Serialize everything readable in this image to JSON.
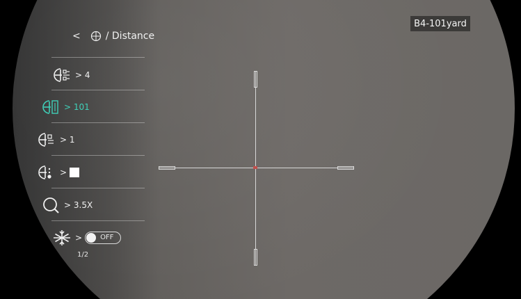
{
  "header": {
    "breadcrumb_chevron": "<",
    "breadcrumb_text": "/ Distance"
  },
  "profile_label": "B4-101yard",
  "menu": {
    "items": [
      {
        "icon": "reticle-group-icon",
        "value": "> 4",
        "active": false
      },
      {
        "icon": "profile-select-icon",
        "value": "> 101",
        "active": true
      },
      {
        "icon": "reticle-style-icon",
        "value": "> 1",
        "active": false
      },
      {
        "icon": "reticle-color-icon",
        "value": ">",
        "swatch_color": "#ffffff",
        "active": false
      },
      {
        "icon": "zoom-icon",
        "value": "> 3.5X",
        "active": false
      },
      {
        "icon": "freeze-icon",
        "value": ">",
        "toggle_label": "OFF",
        "active": false
      }
    ],
    "pager": "1/2"
  },
  "colors": {
    "accent": "#3fd0b8",
    "reticle": "#d8d8d8",
    "reticle_center": "#c0504d"
  }
}
